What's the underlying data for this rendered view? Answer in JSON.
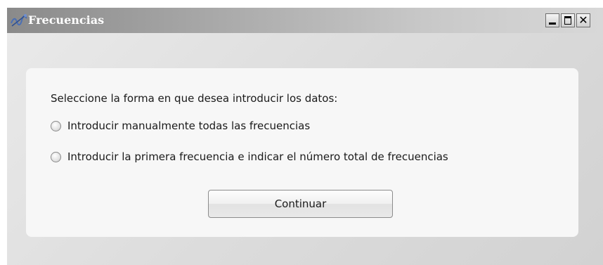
{
  "window": {
    "title": "Frecuencias",
    "icon": "frequency-app-icon",
    "controls": {
      "minimize_icon": "minimize-icon",
      "maximize_icon": "maximize-icon",
      "close_icon": "close-icon",
      "close_glyph": "✕"
    }
  },
  "form": {
    "prompt": "Seleccione la forma en que desea introducir los datos:",
    "options": [
      {
        "label": "Introducir manualmente todas las frecuencias",
        "selected": false
      },
      {
        "label": "Introducir la primera frecuencia e indicar el número total de frecuencias",
        "selected": false
      }
    ],
    "continue_label": "Continuar"
  },
  "colors": {
    "title_text": "#ffffff",
    "panel_background": "#f7f7f7",
    "window_background": "#e0e0e0"
  }
}
